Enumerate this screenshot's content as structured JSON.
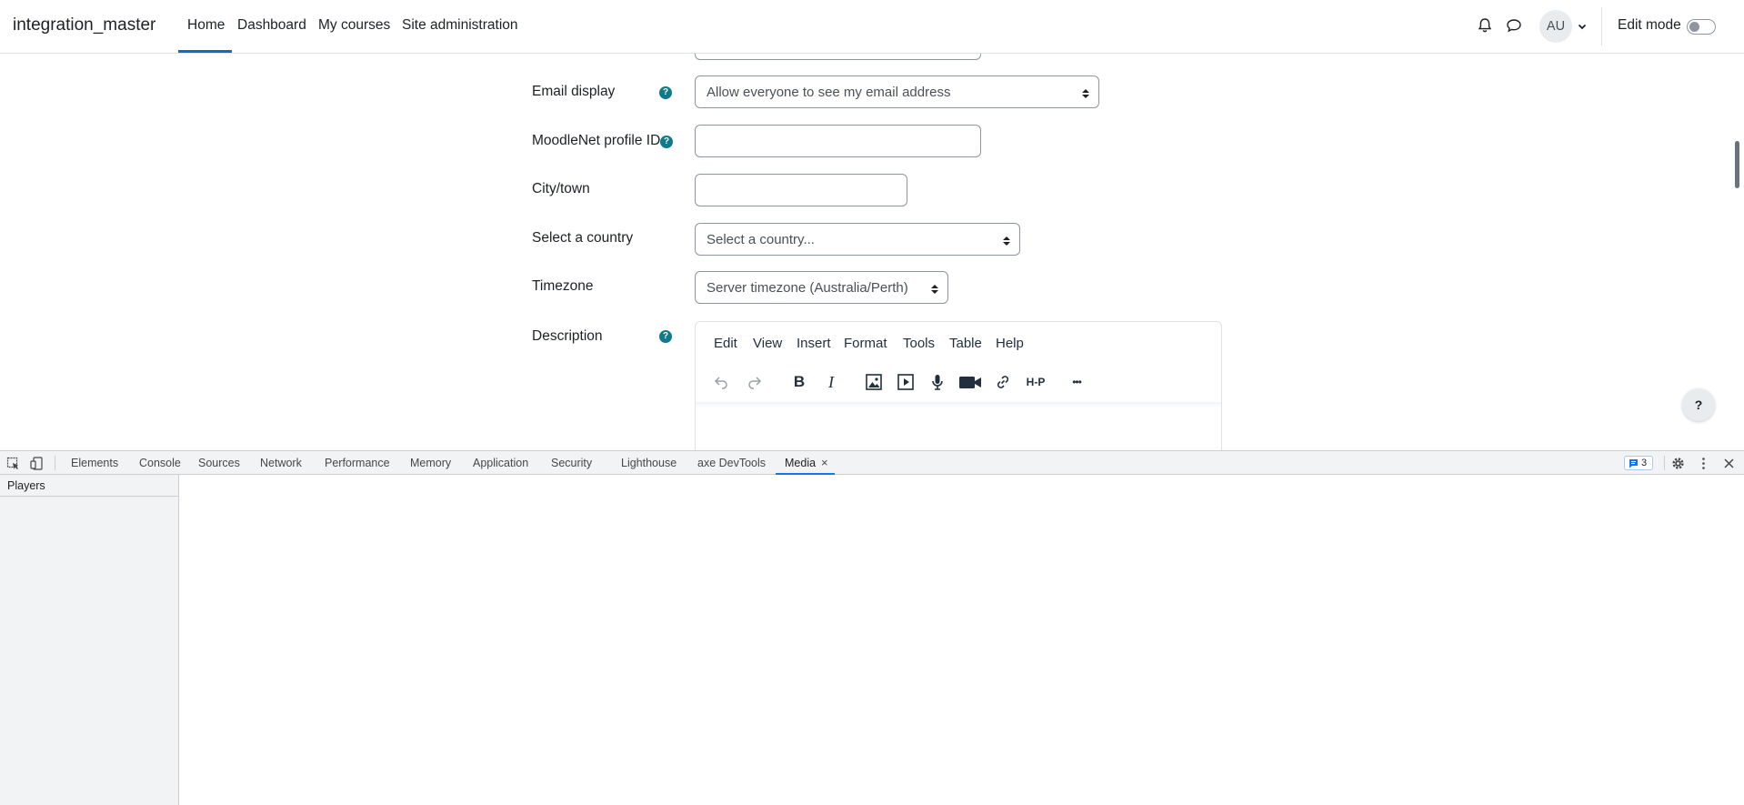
{
  "navbar": {
    "brand": "integration_master",
    "links": [
      {
        "label": "Home",
        "active": true
      },
      {
        "label": "Dashboard",
        "active": false
      },
      {
        "label": "My courses",
        "active": false
      },
      {
        "label": "Site administration",
        "active": false
      }
    ],
    "avatar_initials": "AU",
    "edit_mode_label": "Edit mode",
    "edit_mode_on": false,
    "icons": [
      "bell-icon",
      "chat-icon",
      "chevron-down-icon"
    ]
  },
  "form": {
    "email_display": {
      "label": "Email display",
      "value": "Allow everyone to see my email address"
    },
    "moodlenet": {
      "label": "MoodleNet profile ID",
      "value": ""
    },
    "city": {
      "label": "City/town",
      "value": ""
    },
    "country": {
      "label": "Select a country",
      "value": "Select a country..."
    },
    "timezone": {
      "label": "Timezone",
      "value": "Server timezone (Australia/Perth)"
    },
    "description": {
      "label": "Description"
    },
    "help_glyph": "?"
  },
  "editor": {
    "menu": [
      "Edit",
      "View",
      "Insert",
      "Format",
      "Tools",
      "Table",
      "Help"
    ],
    "toolbar": [
      "undo-icon",
      "redo-icon",
      "bold-icon",
      "italic-icon",
      "image-icon",
      "media-icon",
      "microphone-icon",
      "video-camera-icon",
      "link-icon",
      "h5p-icon",
      "more-icon"
    ],
    "bold_glyph": "B",
    "italic_glyph": "I",
    "h5p_text": "H-P",
    "more_text": "•••"
  },
  "floating_help": "?",
  "devtools": {
    "tabs": [
      "Elements",
      "Console",
      "Sources",
      "Network",
      "Performance",
      "Memory",
      "Application",
      "Security",
      "Lighthouse",
      "axe DevTools",
      "Media"
    ],
    "active_tab": "Media",
    "close_glyph": "×",
    "issues_count": "3",
    "sidebar_title": "Players",
    "accent": "#1a73e8"
  },
  "colors": {
    "primary": "#0f6cbf",
    "help_icon": "#0f7b8a"
  }
}
